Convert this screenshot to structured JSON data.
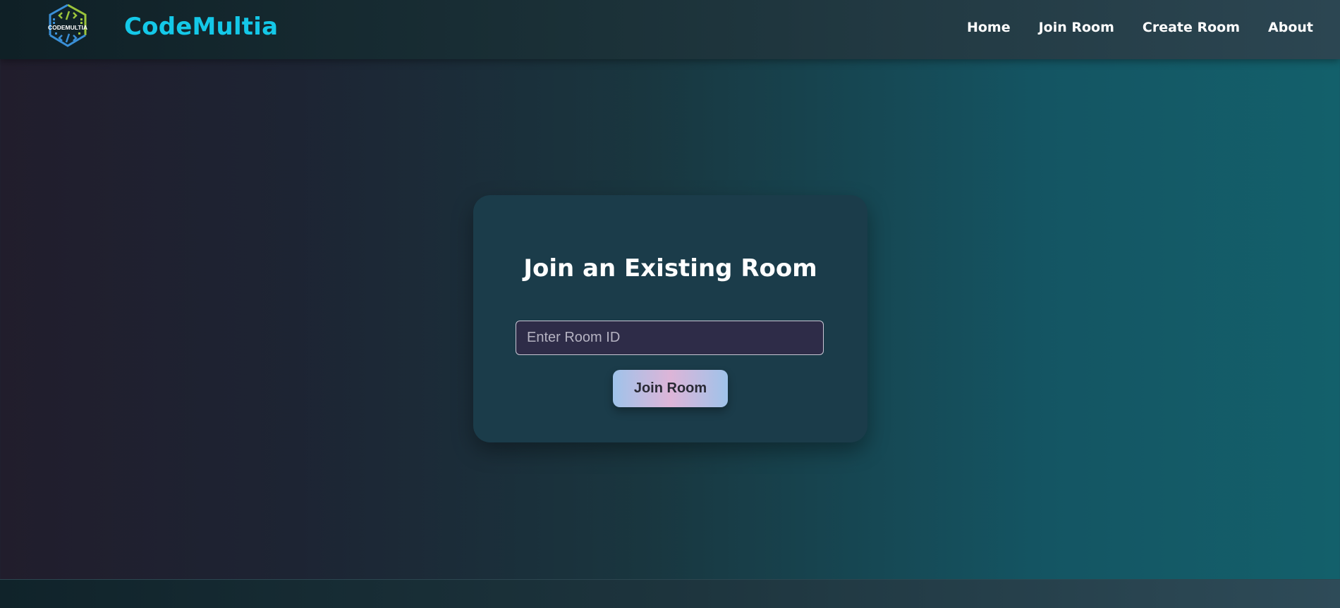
{
  "header": {
    "logo_text": "CODEMULTIA",
    "brand": "CodeMultia",
    "nav": [
      {
        "label": "Home"
      },
      {
        "label": "Join Room"
      },
      {
        "label": "Create Room"
      },
      {
        "label": "About"
      }
    ]
  },
  "card": {
    "title": "Join an Existing Room",
    "input_placeholder": "Enter Room ID",
    "input_value": "",
    "button_label": "Join Room"
  },
  "colors": {
    "brand": "#14c8e8",
    "card_bg": "#1b3c4a",
    "input_bg": "#2e2c48"
  }
}
